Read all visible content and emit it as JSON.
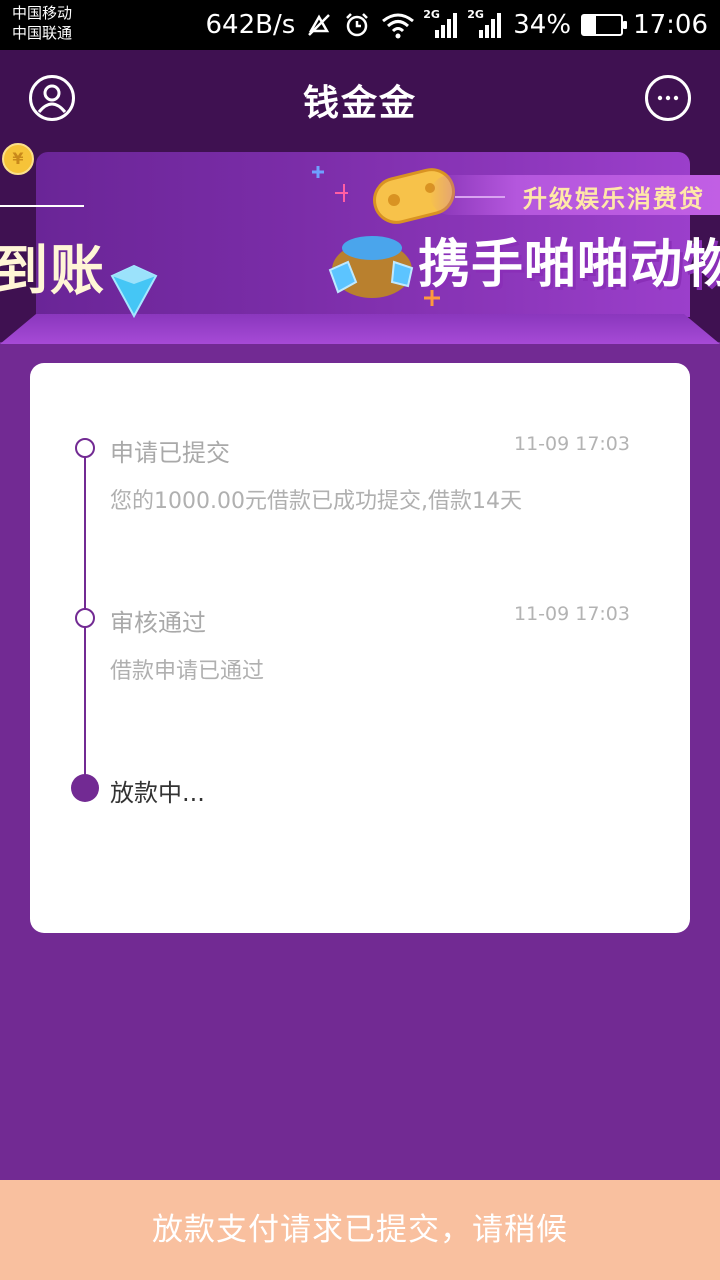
{
  "status_bar": {
    "carrier_1": "中国移动",
    "carrier_2": "中国联通",
    "net_speed": "642B/s",
    "signal_1_tag": "2G",
    "signal_2_tag": "2G",
    "battery_percent": "34%",
    "battery_level": 0.34,
    "time": "17:06"
  },
  "header": {
    "title": "钱金金",
    "left_icon": "user-icon",
    "right_icon": "chat-icon"
  },
  "banner": {
    "left_text": "到账",
    "tag_text": "升级娱乐消费贷",
    "main_text": "携手啪啪动物",
    "coin_symbol": "¥"
  },
  "timeline": [
    {
      "title": "申请已提交",
      "time": "11-09 17:03",
      "desc": "您的1000.00元借款已成功提交,借款14天"
    },
    {
      "title": "审核通过",
      "time": "11-09 17:03",
      "desc": "借款申请已通过"
    },
    {
      "title": "放款中..."
    }
  ],
  "bottom_bar": {
    "label": "放款支付请求已提交，请稍候"
  },
  "colors": {
    "primary": "#722a93",
    "header_bg": "#3f1151",
    "bottom_bar": "#f9c09f"
  }
}
